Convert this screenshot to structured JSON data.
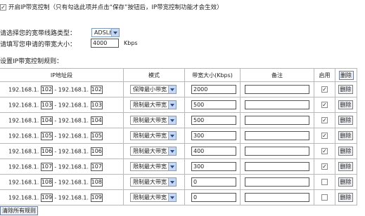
{
  "header": {
    "enable_checked": true,
    "enable_label": "开启IP带宽控制（只有勾选此项并点击“保存”按钮后，IP带宽控制功能才会生效）"
  },
  "line_type": {
    "label": "请选择您的宽带线路类型：",
    "value": "ADSL线路"
  },
  "bandwidth": {
    "label": "请填写您申请的带宽大小：",
    "value": "4000",
    "unit": "Kbps"
  },
  "rules_title": "设置IP带宽控制规则：",
  "table": {
    "headers": {
      "ip_range": "IP地址段",
      "mode": "模式",
      "bandwidth": "带宽大小(Kbps)",
      "note": "备注",
      "enable": "启用",
      "delete": "删除"
    },
    "rows": [
      {
        "prefix1": "192.168.1.",
        "start": "102",
        "dash": "-",
        "prefix2": "192.168.1.",
        "end": "102",
        "mode": "保障最小带宽",
        "bw": "2000",
        "note": "",
        "enabled": true,
        "delete": "删除"
      },
      {
        "prefix1": "192.168.1.",
        "start": "103",
        "dash": "-",
        "prefix2": "192.168.1.",
        "end": "103",
        "mode": "限制最大带宽",
        "bw": "500",
        "note": "",
        "enabled": true,
        "delete": "删除"
      },
      {
        "prefix1": "192.168.1.",
        "start": "104",
        "dash": "-",
        "prefix2": "192.168.1.",
        "end": "104",
        "mode": "限制最大带宽",
        "bw": "500",
        "note": "",
        "enabled": true,
        "delete": "删除"
      },
      {
        "prefix1": "192.168.1.",
        "start": "105",
        "dash": "-",
        "prefix2": "192.168.1.",
        "end": "105",
        "mode": "限制最大带宽",
        "bw": "300",
        "note": "",
        "enabled": true,
        "delete": "删除"
      },
      {
        "prefix1": "192.168.1.",
        "start": "106",
        "dash": "-",
        "prefix2": "192.168.1.",
        "end": "106",
        "mode": "限制最大带宽",
        "bw": "400",
        "note": "",
        "enabled": true,
        "delete": "删除"
      },
      {
        "prefix1": "192.168.1.",
        "start": "107",
        "dash": "-",
        "prefix2": "192.168.1.",
        "end": "107",
        "mode": "限制最大带宽",
        "bw": "300",
        "note": "",
        "enabled": true,
        "delete": "删除"
      },
      {
        "prefix1": "192.168.1.",
        "start": "108",
        "dash": "-",
        "prefix2": "192.168.1.",
        "end": "108",
        "mode": "限制最大带宽",
        "bw": "0",
        "note": "",
        "enabled": false,
        "delete": "删除"
      },
      {
        "prefix1": "192.168.1.",
        "start": "109",
        "dash": "-",
        "prefix2": "192.168.1.",
        "end": "109",
        "mode": "限制最大带宽",
        "bw": "0",
        "note": "",
        "enabled": false,
        "delete": "删除"
      }
    ]
  },
  "clear_all": "清除所有规则",
  "check_mark": "✓"
}
